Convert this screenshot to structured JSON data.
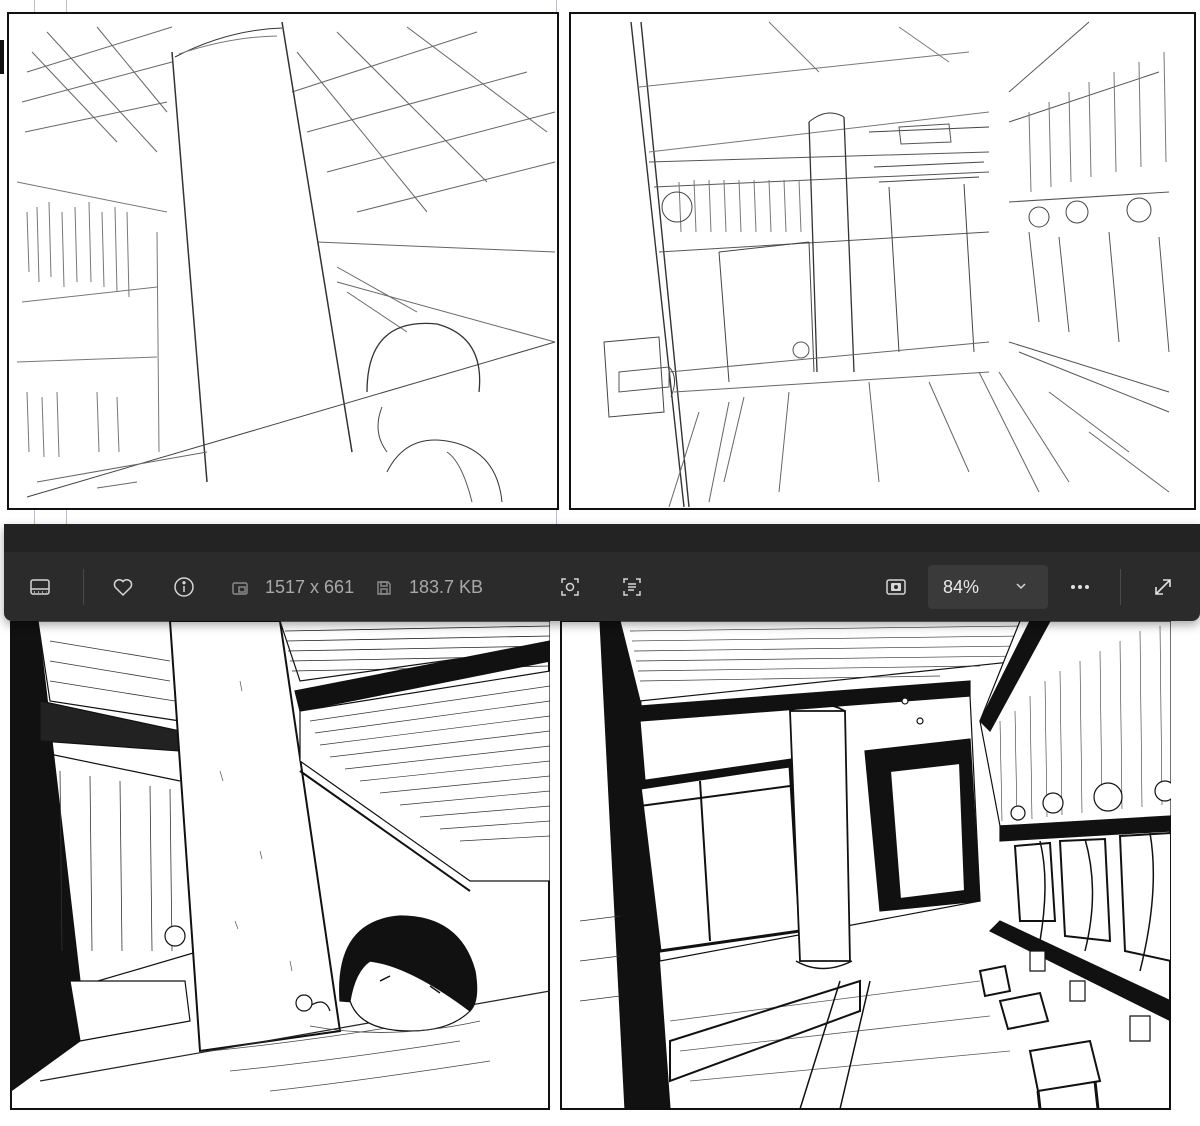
{
  "viewer": {
    "dimensions": "1517 x 661",
    "file_size": "183.7 KB",
    "zoom": "84%",
    "colors": {
      "toolbar_bg": "#2b2b2b",
      "toolbar_text": "#a9a9a9",
      "icon": "#d6d6d6",
      "zoom_box_bg": "#3a3a3a"
    }
  },
  "toolbar_icons": [
    "filmstrip-icon",
    "heart-icon",
    "info-icon",
    "image-dimensions-icon",
    "save-disk-icon",
    "visual-search-icon",
    "text-recognition-icon",
    "fit-to-window-icon",
    "chevron-down-icon",
    "more-options-icon",
    "fullscreen-icon"
  ],
  "panels": [
    {
      "name": "sketch-panel-left",
      "style": "rough pencil sketch"
    },
    {
      "name": "sketch-panel-right",
      "style": "rough pencil sketch"
    },
    {
      "name": "inked-panel-left",
      "style": "inked line art"
    },
    {
      "name": "inked-panel-right",
      "style": "inked line art"
    }
  ]
}
